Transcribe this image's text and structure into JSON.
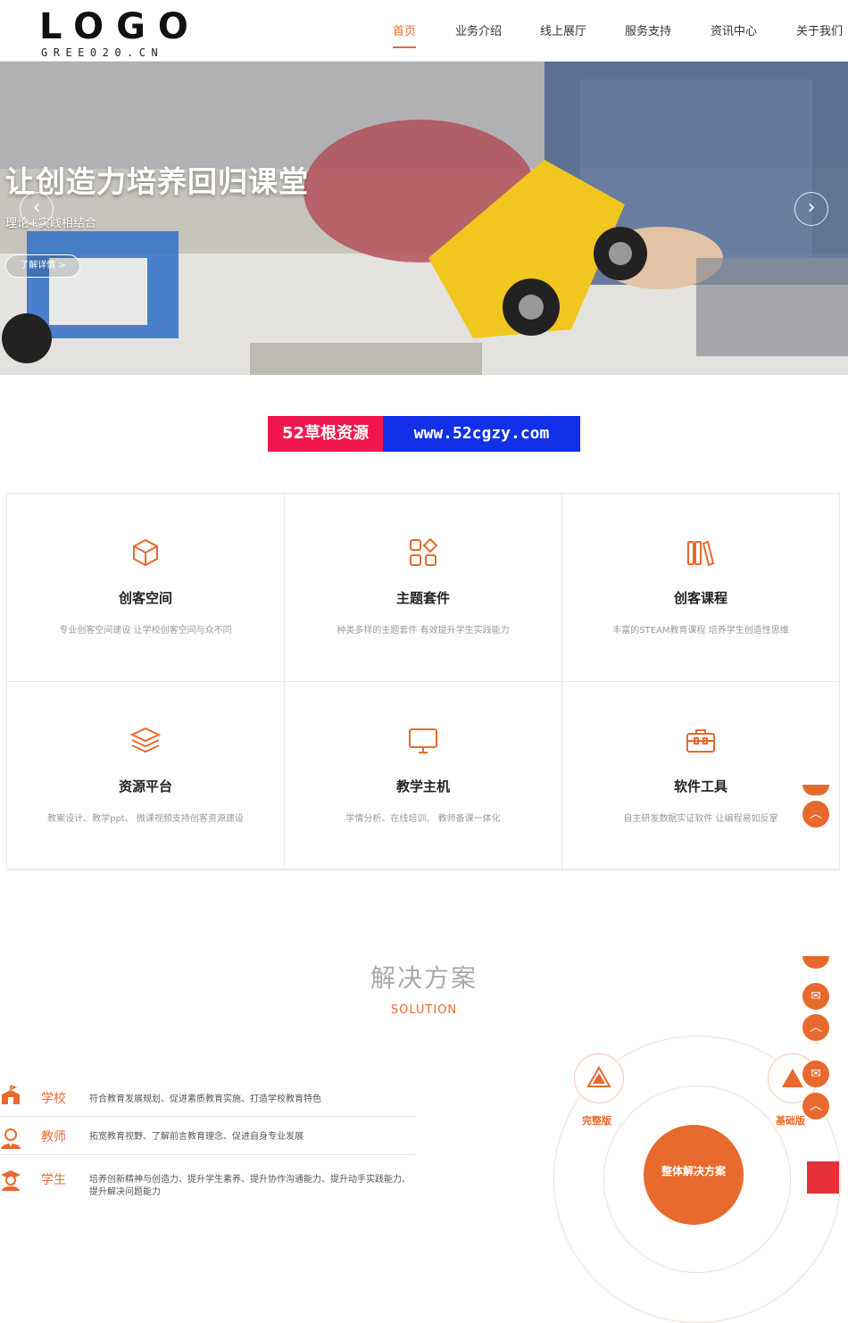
{
  "header": {
    "logo": "LOGO",
    "logo_sub": "GREE020.CN",
    "nav": [
      "首页",
      "业务介绍",
      "线上展厅",
      "服务支持",
      "资讯中心",
      "关于我们"
    ]
  },
  "banner": {
    "title": "让创造力培养回归课堂",
    "subtitle": "理论+实践相结合",
    "button": "了解详情 >",
    "prev": "‹",
    "next": "›"
  },
  "watermark": {
    "left": "52草根资源",
    "right": "www.52cgzy.com"
  },
  "features": [
    {
      "title": "创客空间",
      "desc": "专业创客空间建设 让学校创客空间与众不同",
      "icon": "cube-icon"
    },
    {
      "title": "主题套件",
      "desc": "种类多样的主题套件 有效提升学生实践能力",
      "icon": "apps-icon"
    },
    {
      "title": "创客课程",
      "desc": "丰富的STEAM教育课程 培养学生创造性思维",
      "icon": "books-icon"
    },
    {
      "title": "资源平台",
      "desc": "教案设计、教学ppt、 微课视频支持创客资源建设",
      "icon": "layers-icon"
    },
    {
      "title": "教学主机",
      "desc": "学情分析、在线培训、 教师备课一体化",
      "icon": "monitor-icon"
    },
    {
      "title": "软件工具",
      "desc": "自主研发数据实证软件 让编程易如反掌",
      "icon": "toolbox-icon"
    }
  ],
  "solution": {
    "title": "解决方案",
    "subtitle": "SOLUTION",
    "items": [
      {
        "name": "学校",
        "desc": "符合教育发展规划、促进素质教育实施、打造学校教育特色",
        "icon": "school-icon"
      },
      {
        "name": "教师",
        "desc": "拓宽教育视野、了解前言教育理念、促进自身专业发展",
        "icon": "teacher-icon"
      },
      {
        "name": "学生",
        "desc": "培养创新精神与创造力、提升学生素养、提升协作沟通能力、提升动手实践能力、提升解决问题能力",
        "icon": "student-icon"
      }
    ],
    "badge_left": "完整版",
    "badge_right": "基础版",
    "center": "整体解决方案"
  },
  "colors": {
    "accent": "#e8692d",
    "wm_red": "#f2164f",
    "wm_blue": "#1230e8"
  }
}
